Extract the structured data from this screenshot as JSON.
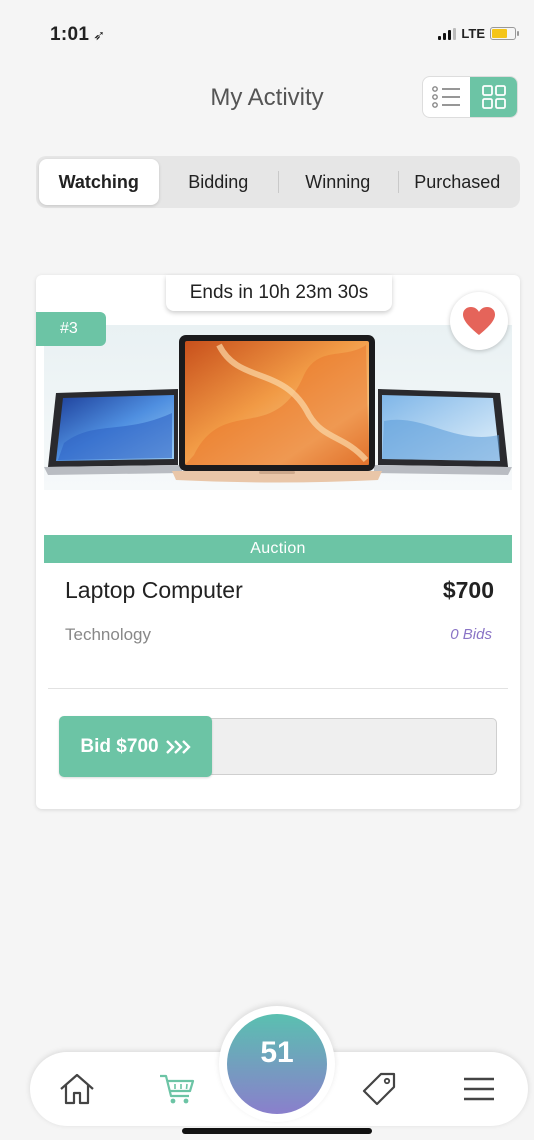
{
  "status_bar": {
    "time": "1:01",
    "network": "LTE"
  },
  "header": {
    "title": "My Activity"
  },
  "tabs": [
    {
      "label": "Watching",
      "active": true
    },
    {
      "label": "Bidding",
      "active": false
    },
    {
      "label": "Winning",
      "active": false
    },
    {
      "label": "Purchased",
      "active": false
    }
  ],
  "card": {
    "timer": "Ends in 10h 23m 30s",
    "rank": "#3",
    "type_label": "Auction",
    "product_name": "Laptop Computer",
    "price": "$700",
    "category": "Technology",
    "bids": "0 Bids",
    "bid_button": "Bid $700"
  },
  "bottom_nav": {
    "center_count": "51"
  },
  "colors": {
    "accent": "#6cc4a5",
    "bids_text": "#8a74c6",
    "heart": "#e5645a"
  }
}
